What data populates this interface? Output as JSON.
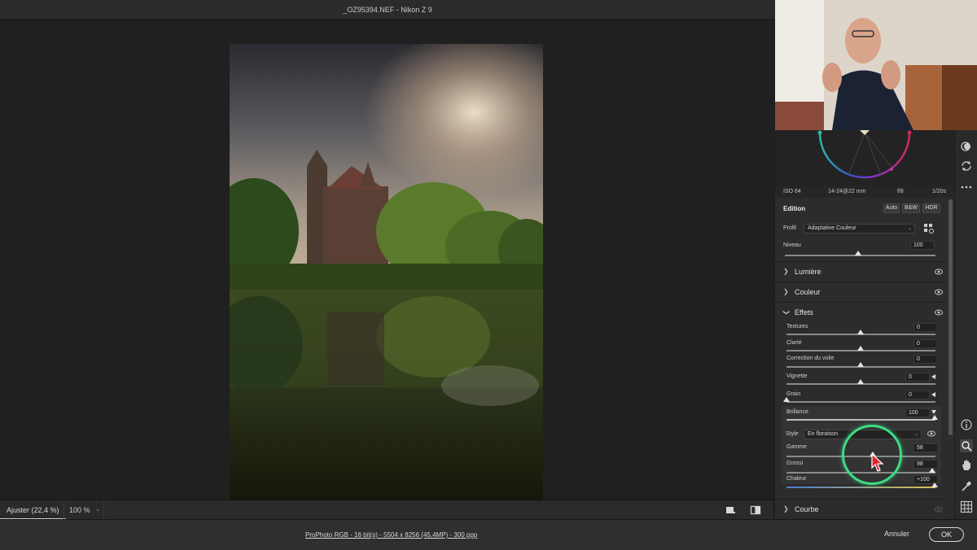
{
  "window": {
    "title": "_OZ95394.NEF  -  Nikon Z 9"
  },
  "zoom_bar": {
    "fit_label": "Ajuster (22,4 %)",
    "zoom_value": "100 %"
  },
  "footer": {
    "workflow_link": "ProPhoto RGB - 16 bit(s) - 5504 x 8256 (45,4MP) - 300 ppp",
    "cancel_label": "Annuler",
    "ok_label": "OK"
  },
  "exif": {
    "iso": "ISO 64",
    "lens": "14-24@22 mm",
    "aperture": "f/8",
    "shutter": "1/20s"
  },
  "edit_header": {
    "title": "Edition",
    "auto": "Auto",
    "bw": "B&W",
    "hdr": "HDR"
  },
  "profile": {
    "label": "Profil",
    "value": "Adaptative Couleur",
    "amount_label": "Niveau",
    "amount_value": "100",
    "amount": 1.0
  },
  "sections": {
    "light": "Lumière",
    "color": "Couleur",
    "effects": "Effets",
    "curve": "Courbe"
  },
  "effects": {
    "texture": {
      "label": "Textures",
      "value": "0"
    },
    "clarity": {
      "label": "Clarté",
      "value": "0"
    },
    "dehaze": {
      "label": "Correction du voile",
      "value": "0"
    },
    "vignette": {
      "label": "Vignette",
      "value": "0"
    },
    "grain": {
      "label": "Grain",
      "value": "0"
    },
    "brilliance": {
      "label": "Brillance",
      "value": "100"
    },
    "style_label": "Style",
    "style_value": "En floraison",
    "range": {
      "label": "Gamme",
      "value": "58"
    },
    "size": {
      "label": "Grossi",
      "value": "98"
    },
    "warmth": {
      "label": "Chaleur",
      "value": "+100"
    }
  },
  "colors": {
    "accent_ring": "#3ddc84",
    "panel_bg": "#2c2c2c",
    "cursor": "#e0252b"
  }
}
